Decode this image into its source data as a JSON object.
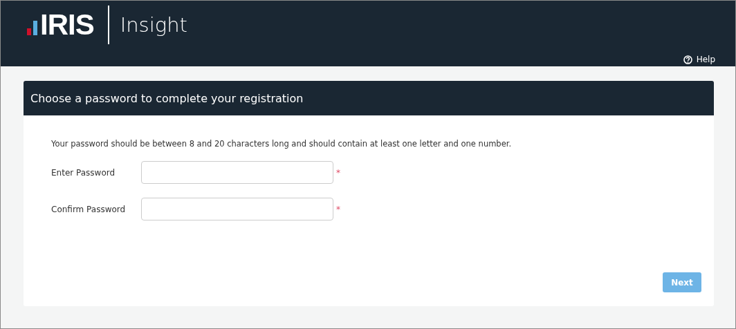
{
  "header": {
    "logo": "IRIS",
    "product": "Insight",
    "help": "Help"
  },
  "panel": {
    "title": "Choose a password to complete your registration",
    "instructions": "Your password should be between 8 and 20 characters long and should contain at least one letter and one number.",
    "fields": [
      {
        "label": "Enter Password",
        "required": true
      },
      {
        "label": "Confirm Password",
        "required": true
      }
    ],
    "required_mark": "*",
    "next_button": {
      "label": "Next",
      "disabled": true
    }
  }
}
